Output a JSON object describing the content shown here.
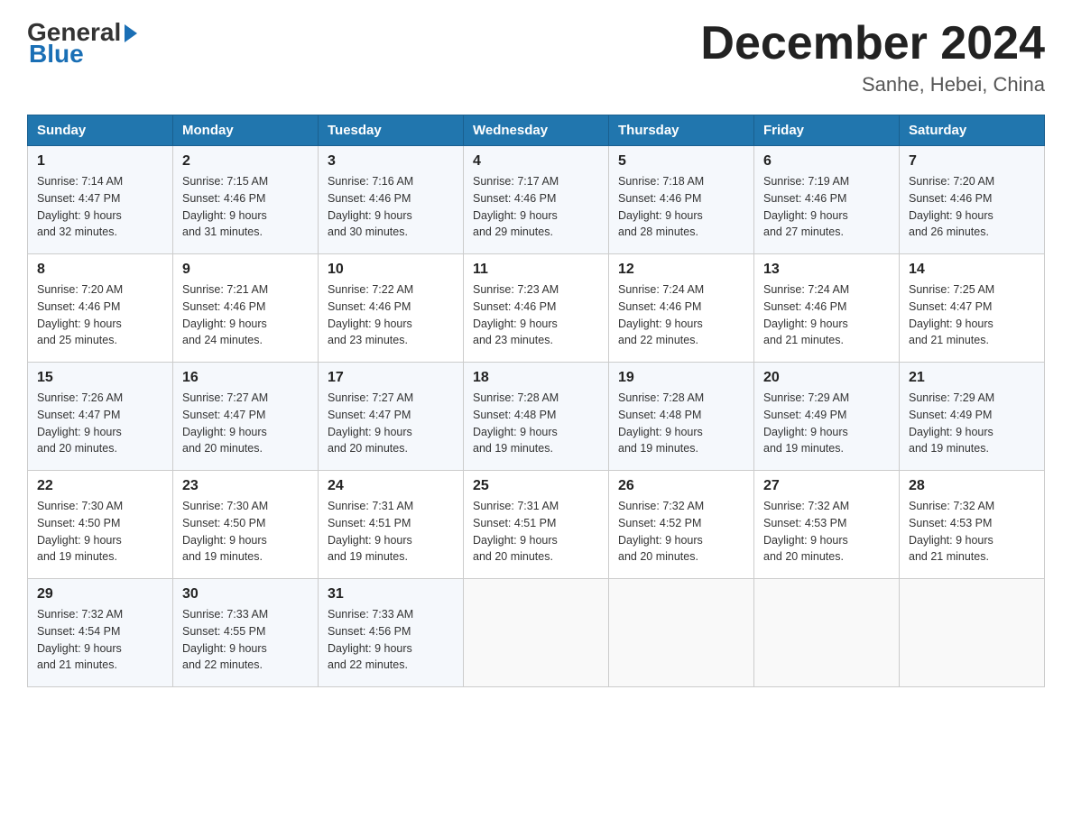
{
  "logo": {
    "general": "General",
    "blue": "Blue"
  },
  "header": {
    "title": "December 2024",
    "subtitle": "Sanhe, Hebei, China"
  },
  "days_of_week": [
    "Sunday",
    "Monday",
    "Tuesday",
    "Wednesday",
    "Thursday",
    "Friday",
    "Saturday"
  ],
  "weeks": [
    [
      {
        "day": "1",
        "sunrise": "7:14 AM",
        "sunset": "4:47 PM",
        "daylight": "9 hours and 32 minutes."
      },
      {
        "day": "2",
        "sunrise": "7:15 AM",
        "sunset": "4:46 PM",
        "daylight": "9 hours and 31 minutes."
      },
      {
        "day": "3",
        "sunrise": "7:16 AM",
        "sunset": "4:46 PM",
        "daylight": "9 hours and 30 minutes."
      },
      {
        "day": "4",
        "sunrise": "7:17 AM",
        "sunset": "4:46 PM",
        "daylight": "9 hours and 29 minutes."
      },
      {
        "day": "5",
        "sunrise": "7:18 AM",
        "sunset": "4:46 PM",
        "daylight": "9 hours and 28 minutes."
      },
      {
        "day": "6",
        "sunrise": "7:19 AM",
        "sunset": "4:46 PM",
        "daylight": "9 hours and 27 minutes."
      },
      {
        "day": "7",
        "sunrise": "7:20 AM",
        "sunset": "4:46 PM",
        "daylight": "9 hours and 26 minutes."
      }
    ],
    [
      {
        "day": "8",
        "sunrise": "7:20 AM",
        "sunset": "4:46 PM",
        "daylight": "9 hours and 25 minutes."
      },
      {
        "day": "9",
        "sunrise": "7:21 AM",
        "sunset": "4:46 PM",
        "daylight": "9 hours and 24 minutes."
      },
      {
        "day": "10",
        "sunrise": "7:22 AM",
        "sunset": "4:46 PM",
        "daylight": "9 hours and 23 minutes."
      },
      {
        "day": "11",
        "sunrise": "7:23 AM",
        "sunset": "4:46 PM",
        "daylight": "9 hours and 23 minutes."
      },
      {
        "day": "12",
        "sunrise": "7:24 AM",
        "sunset": "4:46 PM",
        "daylight": "9 hours and 22 minutes."
      },
      {
        "day": "13",
        "sunrise": "7:24 AM",
        "sunset": "4:46 PM",
        "daylight": "9 hours and 21 minutes."
      },
      {
        "day": "14",
        "sunrise": "7:25 AM",
        "sunset": "4:47 PM",
        "daylight": "9 hours and 21 minutes."
      }
    ],
    [
      {
        "day": "15",
        "sunrise": "7:26 AM",
        "sunset": "4:47 PM",
        "daylight": "9 hours and 20 minutes."
      },
      {
        "day": "16",
        "sunrise": "7:27 AM",
        "sunset": "4:47 PM",
        "daylight": "9 hours and 20 minutes."
      },
      {
        "day": "17",
        "sunrise": "7:27 AM",
        "sunset": "4:47 PM",
        "daylight": "9 hours and 20 minutes."
      },
      {
        "day": "18",
        "sunrise": "7:28 AM",
        "sunset": "4:48 PM",
        "daylight": "9 hours and 19 minutes."
      },
      {
        "day": "19",
        "sunrise": "7:28 AM",
        "sunset": "4:48 PM",
        "daylight": "9 hours and 19 minutes."
      },
      {
        "day": "20",
        "sunrise": "7:29 AM",
        "sunset": "4:49 PM",
        "daylight": "9 hours and 19 minutes."
      },
      {
        "day": "21",
        "sunrise": "7:29 AM",
        "sunset": "4:49 PM",
        "daylight": "9 hours and 19 minutes."
      }
    ],
    [
      {
        "day": "22",
        "sunrise": "7:30 AM",
        "sunset": "4:50 PM",
        "daylight": "9 hours and 19 minutes."
      },
      {
        "day": "23",
        "sunrise": "7:30 AM",
        "sunset": "4:50 PM",
        "daylight": "9 hours and 19 minutes."
      },
      {
        "day": "24",
        "sunrise": "7:31 AM",
        "sunset": "4:51 PM",
        "daylight": "9 hours and 19 minutes."
      },
      {
        "day": "25",
        "sunrise": "7:31 AM",
        "sunset": "4:51 PM",
        "daylight": "9 hours and 20 minutes."
      },
      {
        "day": "26",
        "sunrise": "7:32 AM",
        "sunset": "4:52 PM",
        "daylight": "9 hours and 20 minutes."
      },
      {
        "day": "27",
        "sunrise": "7:32 AM",
        "sunset": "4:53 PM",
        "daylight": "9 hours and 20 minutes."
      },
      {
        "day": "28",
        "sunrise": "7:32 AM",
        "sunset": "4:53 PM",
        "daylight": "9 hours and 21 minutes."
      }
    ],
    [
      {
        "day": "29",
        "sunrise": "7:32 AM",
        "sunset": "4:54 PM",
        "daylight": "9 hours and 21 minutes."
      },
      {
        "day": "30",
        "sunrise": "7:33 AM",
        "sunset": "4:55 PM",
        "daylight": "9 hours and 22 minutes."
      },
      {
        "day": "31",
        "sunrise": "7:33 AM",
        "sunset": "4:56 PM",
        "daylight": "9 hours and 22 minutes."
      },
      null,
      null,
      null,
      null
    ]
  ],
  "labels": {
    "sunrise": "Sunrise:",
    "sunset": "Sunset:",
    "daylight": "Daylight:"
  }
}
